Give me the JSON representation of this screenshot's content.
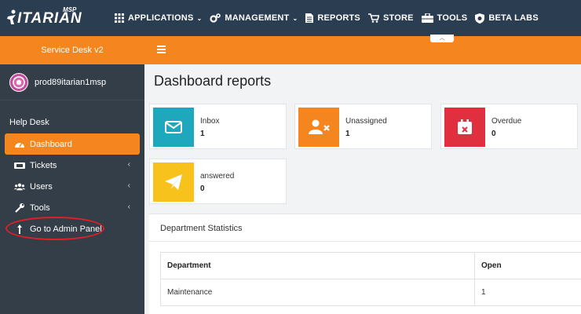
{
  "logo": {
    "text": "ITARIAN",
    "badge": "MSP"
  },
  "nav": [
    {
      "label": "APPLICATIONS",
      "icon": "grid-icon",
      "caret": "⌄"
    },
    {
      "label": "MANAGEMENT",
      "icon": "gears-icon",
      "caret": "⌄"
    },
    {
      "label": "REPORTS",
      "icon": "document-icon"
    },
    {
      "label": "STORE",
      "icon": "cart-icon"
    },
    {
      "label": "TOOLS",
      "icon": "toolbox-icon"
    },
    {
      "label": "BETA LABS",
      "icon": "shield-icon"
    }
  ],
  "sidebar": {
    "header": "Service Desk v2",
    "user_name": "prod89itarian1msp",
    "section": "Help Desk",
    "items": [
      {
        "label": "Dashboard",
        "icon": "dashboard-icon",
        "active": true
      },
      {
        "label": "Tickets",
        "icon": "ticket-icon",
        "chevron": "‹"
      },
      {
        "label": "Users",
        "icon": "users-icon",
        "chevron": "‹"
      },
      {
        "label": "Tools",
        "icon": "wrench-icon",
        "chevron": "‹"
      },
      {
        "label": "Go to Admin Panel",
        "icon": "arrow-up-icon"
      }
    ]
  },
  "main": {
    "title": "Dashboard reports",
    "cards": [
      {
        "label": "Inbox",
        "value": "1",
        "color": "#1ea7bd",
        "icon": "envelope-icon"
      },
      {
        "label": "Unassigned",
        "value": "1",
        "color": "#f5861f",
        "icon": "user-x-icon"
      },
      {
        "label": "Overdue",
        "value": "0",
        "color": "#e0303f",
        "icon": "calendar-x-icon"
      },
      {
        "label": "answered",
        "value": "0",
        "color": "#f7c21b",
        "icon": "paper-plane-icon"
      }
    ],
    "department": {
      "title": "Department Statistics",
      "headers": [
        "Department",
        "Open"
      ],
      "rows": [
        [
          "Maintenance",
          "1"
        ]
      ]
    }
  },
  "colors": {
    "topbar": "#2b3d50",
    "accent": "#f5861f",
    "sidebar": "#343e48"
  }
}
